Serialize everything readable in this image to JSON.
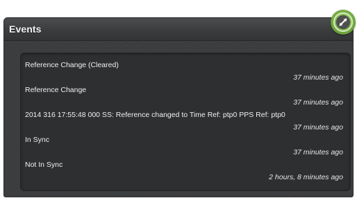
{
  "panel": {
    "title": "Events"
  },
  "events": [
    {
      "message": "Reference Change (Cleared)",
      "time": "37 minutes ago"
    },
    {
      "message": "Reference Change",
      "time": "37 minutes ago"
    },
    {
      "message": "2014 316 17:55:48 000 SS: Reference changed to Time Ref: ptp0 PPS Ref: ptp0",
      "time": "37 minutes ago"
    },
    {
      "message": "In Sync",
      "time": "37 minutes ago"
    },
    {
      "message": "Not In Sync",
      "time": "2 hours, 8 minutes ago"
    }
  ],
  "icons": {
    "collapse": "collapse-arrows-icon"
  },
  "colors": {
    "panel_bg": "#3a3b3d",
    "list_bg": "#2e2f31",
    "text": "#f0f0f0",
    "accent_green": "#78ad45"
  }
}
